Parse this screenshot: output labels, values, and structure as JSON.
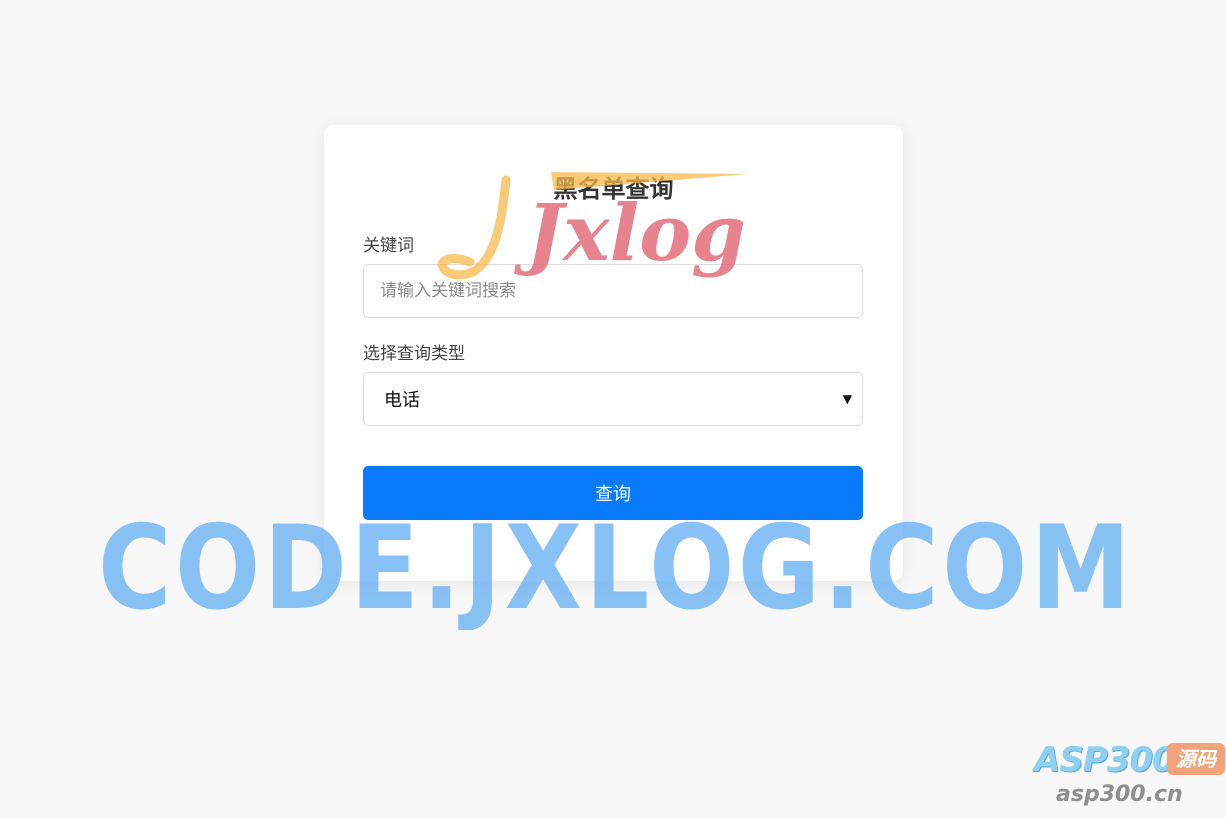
{
  "card": {
    "title": "黑名单查询",
    "keyword_label": "关键词",
    "keyword_placeholder": "请输入关键词搜索",
    "keyword_value": "",
    "type_label": "选择查询类型",
    "type_selected": "电话",
    "submit_label": "查询"
  },
  "watermarks": {
    "logo_text": "Jxlog",
    "site_text": "CODE.JXLOG.COM",
    "asp_brand": "ASP300",
    "asp_badge": "源码",
    "asp_url": "asp300.cn"
  },
  "colors": {
    "page_bg": "#f7f7f7",
    "card_bg": "#ffffff",
    "primary": "#0a7bfd",
    "watermark_blue": "#6fb4f3",
    "logo_yellow": "#f7b94c",
    "logo_red": "#de5a6a"
  }
}
